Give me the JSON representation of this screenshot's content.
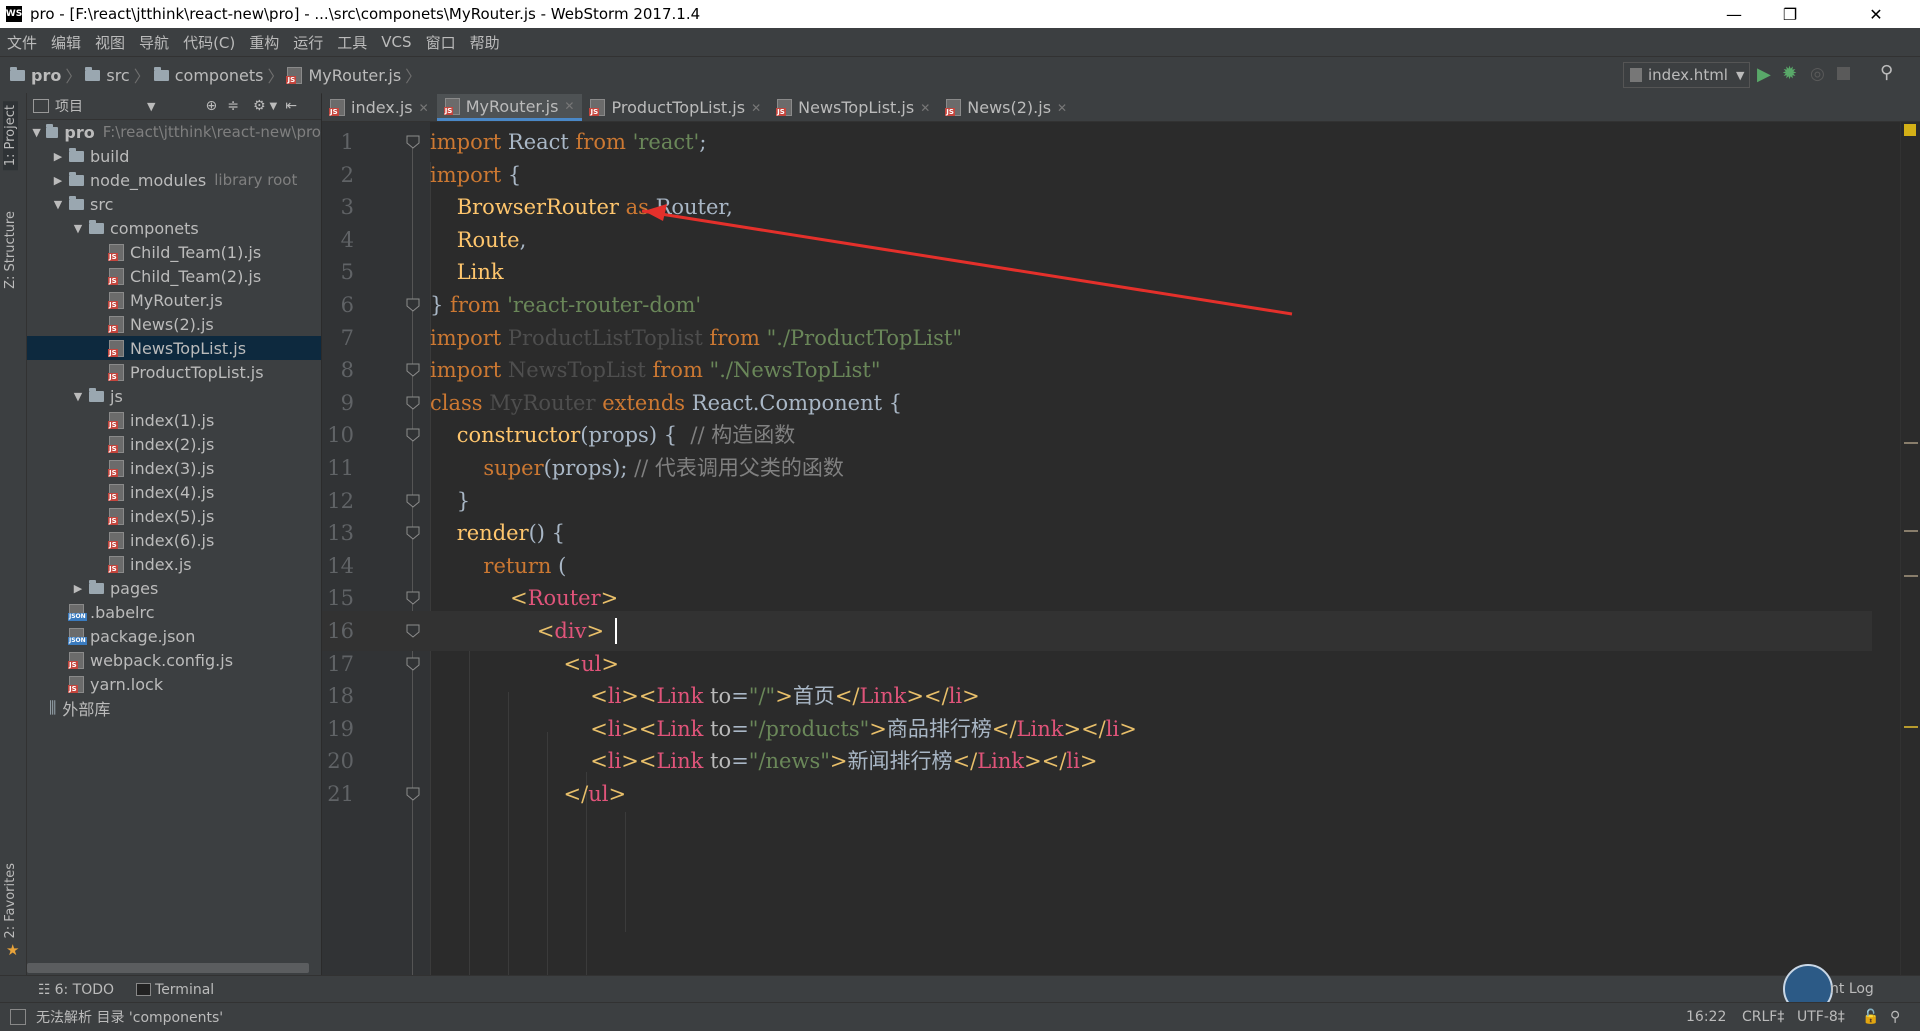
{
  "window": {
    "title": "pro - [F:\\react\\jtthink\\react-new\\pro] - ...\\src\\componets\\MyRouter.js - WebStorm 2017.1.4",
    "app_icon": "WS"
  },
  "menu": [
    "文件",
    "编辑",
    "视图",
    "导航",
    "代码(C)",
    "重构",
    "运行",
    "工具",
    "VCS",
    "窗口",
    "帮助"
  ],
  "breadcrumb": [
    "pro",
    "src",
    "componets",
    "MyRouter.js"
  ],
  "run_config": "index.html",
  "project_panel": {
    "label": "项目",
    "tree": [
      {
        "name": "pro",
        "note": "F:\\react\\jtthink\\react-new\\pro",
        "type": "folder",
        "depth": 0,
        "arrow": "▼",
        "bold": true
      },
      {
        "name": "build",
        "type": "folder",
        "depth": 1,
        "arrow": "▶"
      },
      {
        "name": "node_modules",
        "note": "library root",
        "type": "folder",
        "depth": 1,
        "arrow": "▶"
      },
      {
        "name": "src",
        "type": "folder",
        "depth": 1,
        "arrow": "▼"
      },
      {
        "name": "componets",
        "type": "folder",
        "depth": 2,
        "arrow": "▼"
      },
      {
        "name": "Child_Team(1).js",
        "type": "js",
        "depth": 3
      },
      {
        "name": "Child_Team(2).js",
        "type": "js",
        "depth": 3
      },
      {
        "name": "MyRouter.js",
        "type": "js",
        "depth": 3
      },
      {
        "name": "News(2).js",
        "type": "js",
        "depth": 3
      },
      {
        "name": "NewsTopList.js",
        "type": "js",
        "depth": 3,
        "selected": true
      },
      {
        "name": "ProductTopList.js",
        "type": "js",
        "depth": 3
      },
      {
        "name": "js",
        "type": "folder",
        "depth": 2,
        "arrow": "▼"
      },
      {
        "name": "index(1).js",
        "type": "js",
        "depth": 3
      },
      {
        "name": "index(2).js",
        "type": "js",
        "depth": 3
      },
      {
        "name": "index(3).js",
        "type": "js",
        "depth": 3
      },
      {
        "name": "index(4).js",
        "type": "js",
        "depth": 3
      },
      {
        "name": "index(5).js",
        "type": "js",
        "depth": 3
      },
      {
        "name": "index(6).js",
        "type": "js",
        "depth": 3
      },
      {
        "name": "index.js",
        "type": "js",
        "depth": 3
      },
      {
        "name": "pages",
        "type": "folder",
        "depth": 2,
        "arrow": "▶"
      },
      {
        "name": ".babelrc",
        "type": "json",
        "depth": 1
      },
      {
        "name": "package.json",
        "type": "json",
        "depth": 1
      },
      {
        "name": "webpack.config.js",
        "type": "js",
        "depth": 1
      },
      {
        "name": "yarn.lock",
        "type": "js",
        "depth": 1
      },
      {
        "name": "外部库",
        "type": "lib",
        "depth": 0
      }
    ]
  },
  "side_tabs": {
    "project": "1: Project",
    "structure": "Z: Structure",
    "favorites": "2: Favorites"
  },
  "editor_tabs": [
    {
      "label": "index.js",
      "active": false
    },
    {
      "label": "MyRouter.js",
      "active": true
    },
    {
      "label": "ProductTopList.js",
      "active": false
    },
    {
      "label": "NewsTopList.js",
      "active": false
    },
    {
      "label": "News(2).js",
      "active": false
    }
  ],
  "code_lines": [
    "import React from 'react';",
    "import {",
    "    BrowserRouter as Router,",
    "    Route,",
    "    Link",
    "} from 'react-router-dom'",
    "import ProductListToplist from \"./ProductTopList\"",
    "import NewsTopList from \"./NewsTopList\"",
    "class MyRouter extends React.Component {",
    "    constructor(props) {  // 构造函数",
    "        super(props); // 代表调用父类的函数",
    "    }",
    "    render() {",
    "        return (",
    "            <Router>",
    "                <div>",
    "                    <ul>",
    "                        <li><Link to=\"/\">首页</Link></li>",
    "                        <li><Link to=\"/products\">商品排行榜</Link></li>",
    "                        <li><Link to=\"/news\">新闻排行榜</Link></li>",
    "                    </ul>"
  ],
  "current_line": 16,
  "bottom_tools": {
    "todo": "6: TODO",
    "terminal": "Terminal",
    "event_log": "nt Log"
  },
  "status": {
    "message": "无法解析 目录 'components'",
    "position": "16:22",
    "line_sep": "CRLF‡",
    "encoding": "UTF-8‡"
  }
}
